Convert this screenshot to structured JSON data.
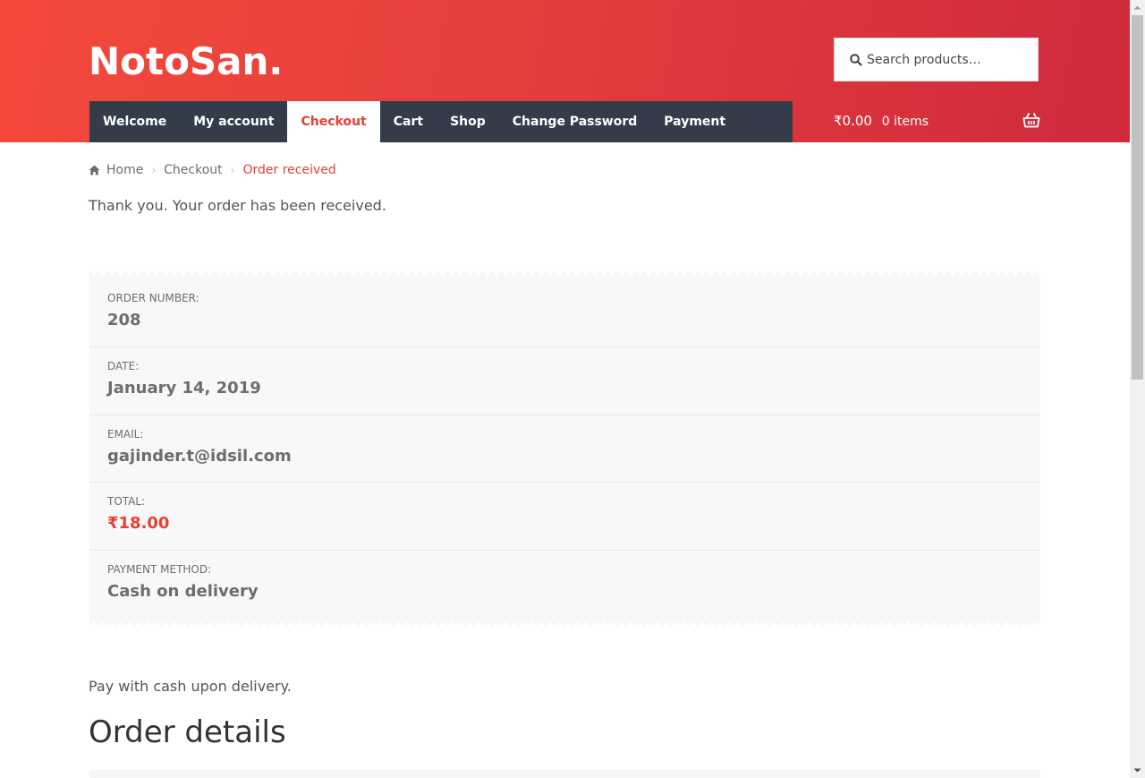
{
  "site": {
    "logo": "NotoSan."
  },
  "search": {
    "placeholder": "Search products…"
  },
  "nav": {
    "items": [
      {
        "label": "Welcome",
        "active": false
      },
      {
        "label": "My account",
        "active": false
      },
      {
        "label": "Checkout",
        "active": true
      },
      {
        "label": "Cart",
        "active": false
      },
      {
        "label": "Shop",
        "active": false
      },
      {
        "label": "Change Password",
        "active": false
      },
      {
        "label": "Payment",
        "active": false
      }
    ]
  },
  "cart": {
    "amount": "₹0.00",
    "count": "0 items",
    "icon": "basket-icon"
  },
  "breadcrumb": {
    "home": "Home",
    "checkout": "Checkout",
    "current": "Order received",
    "icon": "home-icon"
  },
  "message": "Thank you. Your order has been received.",
  "order_overview": {
    "order_number_label": "Order number:",
    "order_number": "208",
    "date_label": "Date:",
    "date": "January 14, 2019",
    "email_label": "Email:",
    "email": "gajinder.t@idsil.com",
    "total_label": "Total:",
    "total": "₹18.00",
    "payment_method_label": "Payment method:",
    "payment_method": "Cash on delivery"
  },
  "payment_note": "Pay with cash upon delivery.",
  "order_details_title": "Order details",
  "colors": {
    "accent": "#e54134",
    "header_gradient_start": "#f4493b",
    "header_gradient_end": "#cf2a3c",
    "nav_background": "#333c48"
  }
}
